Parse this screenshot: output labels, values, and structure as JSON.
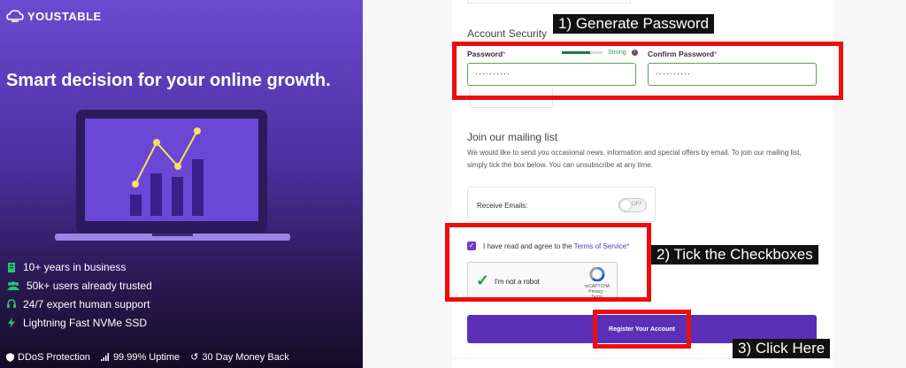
{
  "brand": {
    "name": "YOUSTABLE"
  },
  "promo": {
    "headline": "Smart decision for your online growth.",
    "features": [
      {
        "icon": "building-icon",
        "text": "10+ years in business"
      },
      {
        "icon": "users-icon",
        "text": "50k+ users already trusted"
      },
      {
        "icon": "headset-icon",
        "text": "24/7 expert human support"
      },
      {
        "icon": "lightning-icon",
        "text": "Lightning Fast NVMe SSD"
      }
    ],
    "bottom": [
      {
        "icon": "shield-icon",
        "text": "DDoS Protection"
      },
      {
        "icon": "signal-icon",
        "text": "99.99% Uptime"
      },
      {
        "icon": "undo-icon",
        "text": "30 Day Money Back"
      }
    ]
  },
  "form": {
    "security_title": "Account Security",
    "password_label": "Password",
    "password_value": "··········",
    "strength_label": "Strong",
    "strength_level": 0.7,
    "confirm_label": "Confirm Password",
    "confirm_value": "··········",
    "required_mark": "*",
    "mailing_title": "Join our mailing list",
    "mailing_text": "We would like to send you occasional news, information and special offers by email. To join our mailing list, simply tick the box below. You can unsubscribe at any time.",
    "receive_emails_label": "Receive Emails:",
    "toggle_state": "OFF",
    "terms_prefix": "I have read and agree to the ",
    "terms_link": "Terms of Service",
    "recaptcha_label": "I'm not a robot",
    "recaptcha_brand": "reCAPTCHA",
    "recaptcha_links": "Privacy - Terms",
    "register_label": "Register Your Account"
  },
  "annotations": {
    "step1": "1) Generate Password",
    "step2": "2) Tick the Checkboxes",
    "step3": "3) Click Here"
  },
  "colors": {
    "accent": "#5b2fb8",
    "annotation": "#ee0d0d",
    "strong": "#2e9e48"
  }
}
